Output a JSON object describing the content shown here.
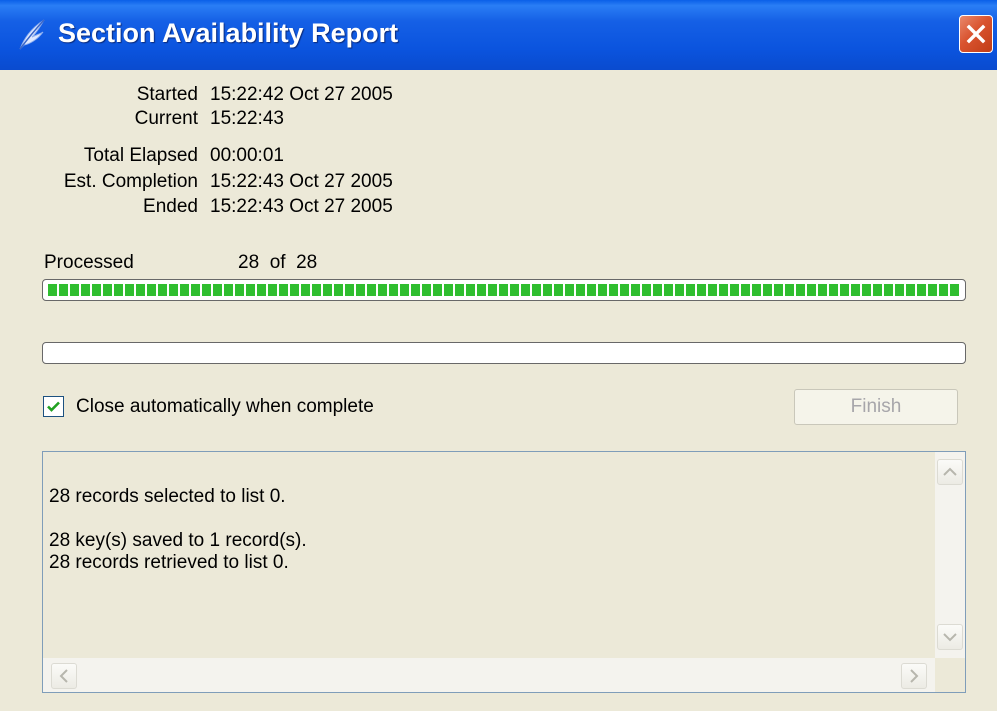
{
  "window": {
    "title": "Section Availability Report",
    "accent": "#0b54de",
    "close_color": "#d9532f"
  },
  "times": {
    "started_label": "Started",
    "started_value": "15:22:42 Oct 27 2005",
    "current_label": "Current",
    "current_value": "15:22:43",
    "elapsed_label": "Total Elapsed",
    "elapsed_value": "00:00:01",
    "est_label": "Est. Completion",
    "est_value": "15:22:43 Oct 27 2005",
    "ended_label": "Ended",
    "ended_value": "15:22:43 Oct 27 2005"
  },
  "progress": {
    "processed_label": "Processed",
    "count_text": "28  of  28",
    "bar1_fraction": 1.0,
    "bar2_fraction": 0.0,
    "bar_color": "#2fbe2f"
  },
  "options": {
    "close_auto_label": "Close automatically when complete",
    "close_auto_checked": true,
    "finish_label": "Finish",
    "finish_enabled": false
  },
  "log": {
    "lines": "28 records selected to list 0.\n\n28 key(s) saved to 1 record(s).\n28 records retrieved to list 0."
  },
  "icons": {
    "app": "feather-icon",
    "close": "close-icon",
    "check": "check-icon",
    "scroll_up": "scroll-up-arrow-icon",
    "scroll_down": "scroll-down-arrow-icon",
    "scroll_left": "scroll-left-arrow-icon",
    "scroll_right": "scroll-right-arrow-icon"
  }
}
